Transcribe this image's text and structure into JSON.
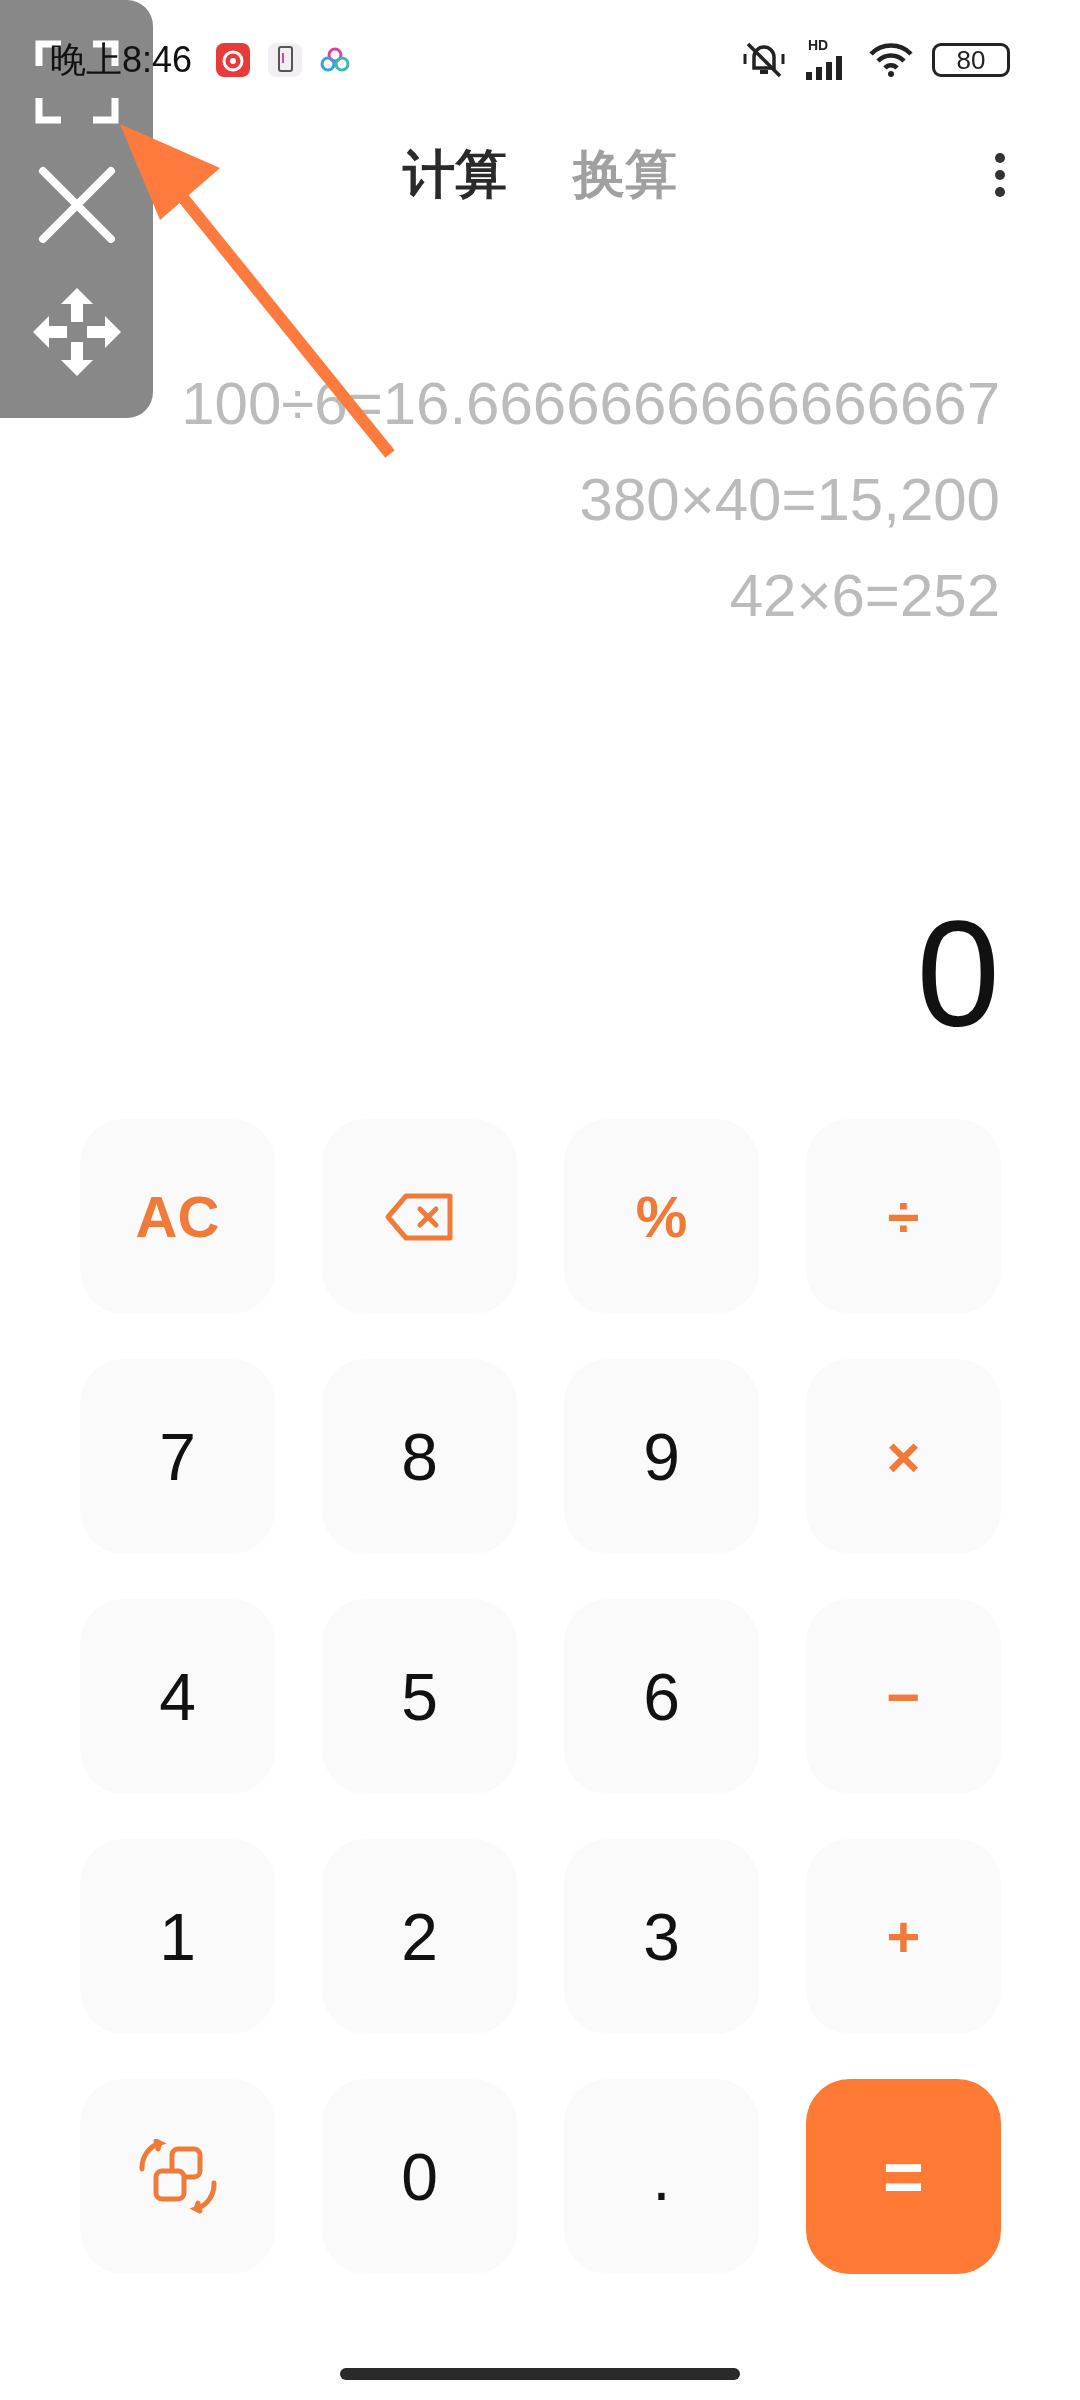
{
  "status_bar": {
    "time": "晚上8:46",
    "network": "HD",
    "battery": "80"
  },
  "tabs": [
    {
      "label": "计算",
      "selected": true
    },
    {
      "label": "换算",
      "selected": false
    }
  ],
  "history": [
    "100÷6=16.6666666666666667",
    "380×40=15,200",
    "42×6=252"
  ],
  "display": "0",
  "keys": [
    {
      "kind": "op",
      "label": "AC"
    },
    {
      "kind": "backspace"
    },
    {
      "kind": "op",
      "label": "%"
    },
    {
      "kind": "op",
      "label": "÷"
    },
    {
      "kind": "digit",
      "label": "7"
    },
    {
      "kind": "digit",
      "label": "8"
    },
    {
      "kind": "digit",
      "label": "9"
    },
    {
      "kind": "op",
      "label": "×"
    },
    {
      "kind": "digit",
      "label": "4"
    },
    {
      "kind": "digit",
      "label": "5"
    },
    {
      "kind": "digit",
      "label": "6"
    },
    {
      "kind": "op",
      "label": "−"
    },
    {
      "kind": "digit",
      "label": "1"
    },
    {
      "kind": "digit",
      "label": "2"
    },
    {
      "kind": "digit",
      "label": "3"
    },
    {
      "kind": "op",
      "label": "+"
    },
    {
      "kind": "swap"
    },
    {
      "kind": "digit",
      "label": "0"
    },
    {
      "kind": "digit",
      "label": "."
    },
    {
      "kind": "equals",
      "label": "="
    }
  ]
}
